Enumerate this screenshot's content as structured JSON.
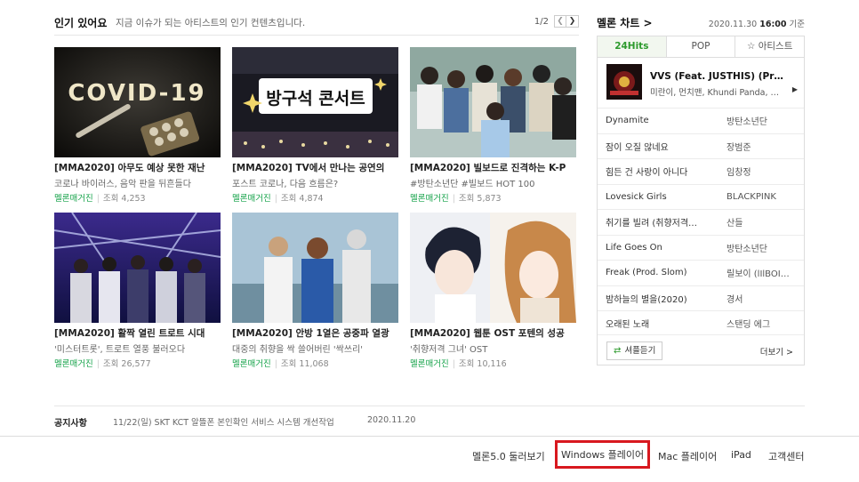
{
  "popular": {
    "title": "인기 있어요",
    "description": "지금 이슈가 되는 아티스트의 인기 컨텐츠입니다.",
    "page": "1/2",
    "prev_icon": "chevron-left-icon",
    "next_icon": "chevron-right-icon",
    "cards": [
      {
        "title": "[MMA2020] 아무도 예상 못한 재난",
        "subtitle": "코로나 바이러스, 음악 판을 뒤흔들다",
        "source": "멜론매거진",
        "views": "조회 4,253",
        "thumb_text": "COVID-19"
      },
      {
        "title": "[MMA2020] TV에서 만나는 공연의",
        "subtitle": "포스트 코로나, 다음 흐름은?",
        "source": "멜론매거진",
        "views": "조회 4,874",
        "thumb_text": "방구석 콘서트"
      },
      {
        "title": "[MMA2020] 빌보드로 진격하는 K-P",
        "subtitle": "#방탄소년단 #빌보드 HOT 100",
        "source": "멜론매거진",
        "views": "조회 5,873",
        "thumb_text": ""
      },
      {
        "title": "[MMA2020] 활짝 열린 트로트 시대",
        "subtitle": "'미스터트롯', 트로트 열풍 불러오다",
        "source": "멜론매거진",
        "views": "조회 26,577",
        "thumb_text": ""
      },
      {
        "title": "[MMA2020] 안방 1열은 공중파 열광",
        "subtitle": "대중의 취향을 싹 쓸어버린 '싹쓰리'",
        "source": "멜론매거진",
        "views": "조회 11,068",
        "thumb_text": ""
      },
      {
        "title": "[MMA2020] 웹툰 OST 포텐의 성공",
        "subtitle": "'취향저격 그녀' OST",
        "source": "멜론매거진",
        "views": "조회 10,116",
        "thumb_text": ""
      }
    ]
  },
  "chart": {
    "title": "멜론 차트",
    "title_arrow": ">",
    "date": "2020.11.30",
    "time": "16:00",
    "date_suffix": "기준",
    "tabs": [
      "24Hits",
      "POP",
      "☆ 아티스트"
    ],
    "active_tab": 0,
    "top1": {
      "song": "VVS (Feat. JUSTHIS) (Pr…",
      "artist": "미란이, 먼치맨, Khundi Panda, …"
    },
    "rows": [
      {
        "song": "Dynamite",
        "artist": "방탄소년단"
      },
      {
        "song": "잠이 오질 않네요",
        "artist": "장범준"
      },
      {
        "song": "힘든 건 사랑이 아니다",
        "artist": "임창정"
      },
      {
        "song": "Lovesick Girls",
        "artist": "BLACKPINK"
      },
      {
        "song": "취기를 빌려 (취향저격…",
        "artist": "산들"
      },
      {
        "song": "Life Goes On",
        "artist": "방탄소년단"
      },
      {
        "song": "Freak (Prod. Slom)",
        "artist": "릴보이 (lIlBOI…"
      },
      {
        "song": "밤하늘의 별을(2020)",
        "artist": "경서"
      },
      {
        "song": "오래된 노래",
        "artist": "스탠딩 에그"
      }
    ],
    "shuffle_label": "셔플듣기",
    "more_label": "더보기 >"
  },
  "notice": {
    "label": "공지사항",
    "text": "11/22(일) SKT KCT 알뜰폰 본인확인 서비스 시스템 개선작업",
    "date": "2020.11.20"
  },
  "footer": {
    "links": [
      "멜론5.0 둘러보기",
      "Windows 플레이어",
      "Mac 플레이어",
      "iPad",
      "고객센터"
    ],
    "highlight_color": "#d8181f",
    "accent_green": "#2d9a2d"
  }
}
